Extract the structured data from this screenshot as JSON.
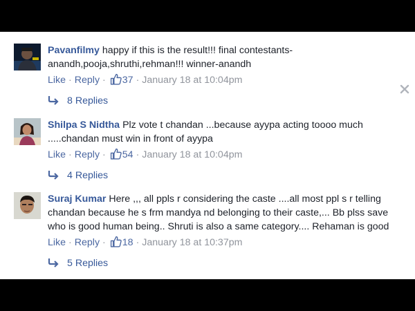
{
  "comments": [
    {
      "author": "Pavanfilmy",
      "text": "happy if this is the result!!! final contestants-anandh,pooja,shruthi,rehman!!! winner-anandh",
      "like_label": "Like",
      "reply_label": "Reply",
      "likes": "37",
      "timestamp": "January 18 at 10:04pm",
      "replies_label": "8 Replies"
    },
    {
      "author": "Shilpa S Nidtha",
      "text": "Plz vote t chandan ...because ayypa acting toooo much .....chandan must win in front of ayypa",
      "like_label": "Like",
      "reply_label": "Reply",
      "likes": "54",
      "timestamp": "January 18 at 10:04pm",
      "replies_label": "4 Replies"
    },
    {
      "author": "Suraj Kumar",
      "text": "Here ,,, all ppls r considering the caste ....all most ppl s r telling chandan because he s frm mandya nd belonging to their caste,... Bb plss save who is good human being.. Shruti is also a same category.... Rehaman is good",
      "like_label": "Like",
      "reply_label": "Reply",
      "likes": "18",
      "timestamp": "January 18 at 10:37pm",
      "replies_label": "5 Replies"
    }
  ],
  "icons": {
    "thumbs_up": "thumbs-up-icon",
    "reply_arrow": "reply-arrow-icon",
    "close": "close-icon"
  },
  "colors": {
    "author": "#365899",
    "link": "#4b67a1",
    "meta": "#90949c",
    "text": "#1d2129"
  }
}
